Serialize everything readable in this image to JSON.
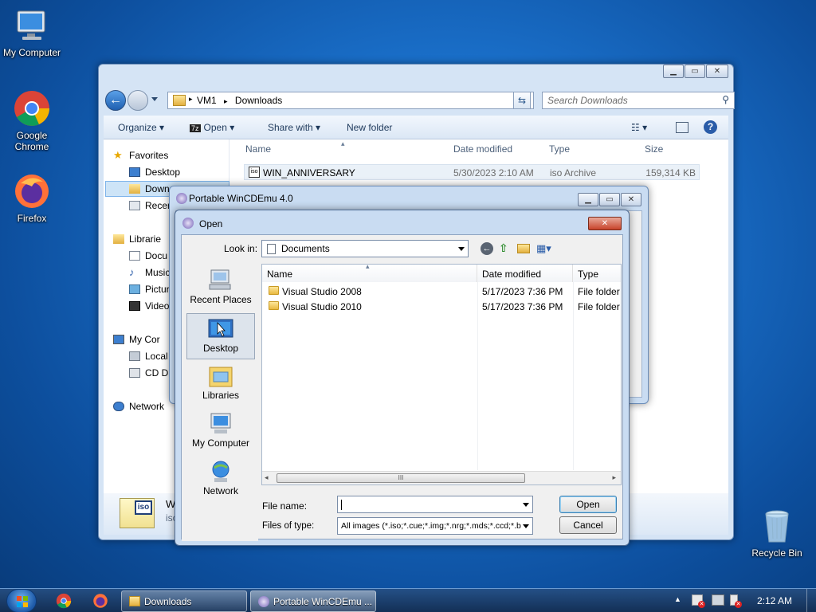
{
  "desktop": {
    "icons": [
      {
        "label": "My Computer"
      },
      {
        "label": "Google Chrome"
      },
      {
        "label": "Firefox"
      },
      {
        "label": "Recycle Bin"
      }
    ]
  },
  "explorer": {
    "breadcrumb": [
      "VM1",
      "Downloads"
    ],
    "search_placeholder": "Search Downloads",
    "toolbar": {
      "organize": "Organize",
      "open": "Open",
      "share_with": "Share with",
      "new_folder": "New folder",
      "open_badge": "7z"
    },
    "nav": {
      "favorites": "Favorites",
      "desktop": "Desktop",
      "downloads": "Down",
      "recent": "Recen",
      "libraries": "Librarie",
      "documents": "Docu",
      "music": "Music",
      "pictures": "Pictur",
      "videos": "Video",
      "my_computer": "My Cor",
      "local": "Local",
      "cd_drive": "CD Dr",
      "network": "Network"
    },
    "columns": {
      "name": "Name",
      "date": "Date modified",
      "type": "Type",
      "size": "Size"
    },
    "rows": [
      {
        "name": "WIN_ANNIVERSARY",
        "date": "5/30/2023 2:10 AM",
        "type": "iso Archive",
        "size": "159,314 KB"
      }
    ],
    "details": {
      "name": "W",
      "sub": "iso",
      "icon_text": "iso"
    }
  },
  "wincdemu": {
    "title": "Portable WinCDEmu 4.0"
  },
  "open_dialog": {
    "title": "Open",
    "look_in_label": "Look in:",
    "look_in_value": "Documents",
    "places": [
      "Recent Places",
      "Desktop",
      "Libraries",
      "My Computer",
      "Network"
    ],
    "columns": {
      "name": "Name",
      "date": "Date modified",
      "type": "Type"
    },
    "rows": [
      {
        "name": "Visual Studio 2008",
        "date": "5/17/2023 7:36 PM",
        "type": "File folder"
      },
      {
        "name": "Visual Studio 2010",
        "date": "5/17/2023 7:36 PM",
        "type": "File folder"
      }
    ],
    "file_name_label": "File name:",
    "file_name_value": "",
    "files_of_type_label": "Files of type:",
    "files_of_type_value": "All images (*.iso;*.cue;*.img;*.nrg;*.mds;*.ccd;*.b",
    "open_button": "Open",
    "cancel_button": "Cancel",
    "scroll_grip": "III"
  },
  "taskbar": {
    "buttons": [
      "Downloads",
      "Portable WinCDEmu ..."
    ],
    "clock": "2:12 AM"
  }
}
